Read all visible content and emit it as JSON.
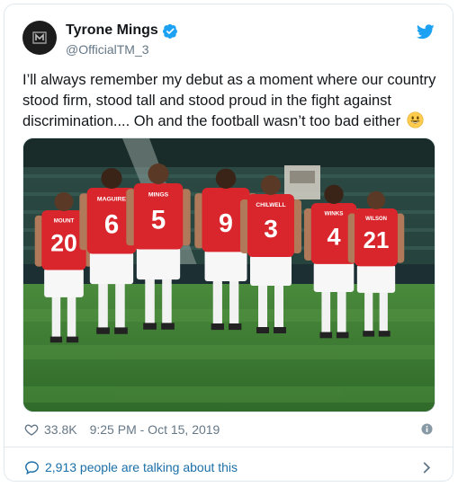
{
  "tweet": {
    "display_name": "Tyrone Mings",
    "handle": "@OfficialTM_3",
    "text": "I’ll always remember my debut as a moment where our country stood firm, stood tall and stood proud in the fight against discrimination.... Oh and the football wasn’t too bad either",
    "emoji": "grinning-face",
    "likes": "33.8K",
    "timestamp": "9:25 PM - Oct 15, 2019",
    "talking": "2,913 people are talking about this"
  },
  "photo": {
    "shirt_names": [
      "MOUNT",
      "MAGUIRE",
      "MINGS",
      "CHILWELL",
      "WINKS",
      "WILSON"
    ],
    "shirt_numbers": [
      "20",
      "6",
      "5",
      "9",
      "3",
      "4",
      "21"
    ]
  },
  "icons": {
    "verified": "verified-badge-icon",
    "platform": "twitter-bird-icon",
    "like": "heart-icon",
    "info": "info-icon",
    "conversation": "speech-bubble-icon",
    "open": "chevron-right-icon"
  },
  "colors": {
    "brand_blue": "#1da1f2",
    "link_blue": "#1b6fa8",
    "secondary_text": "#657786",
    "shirt_red": "#d8262c",
    "pitch_green": "#3f7a35"
  }
}
